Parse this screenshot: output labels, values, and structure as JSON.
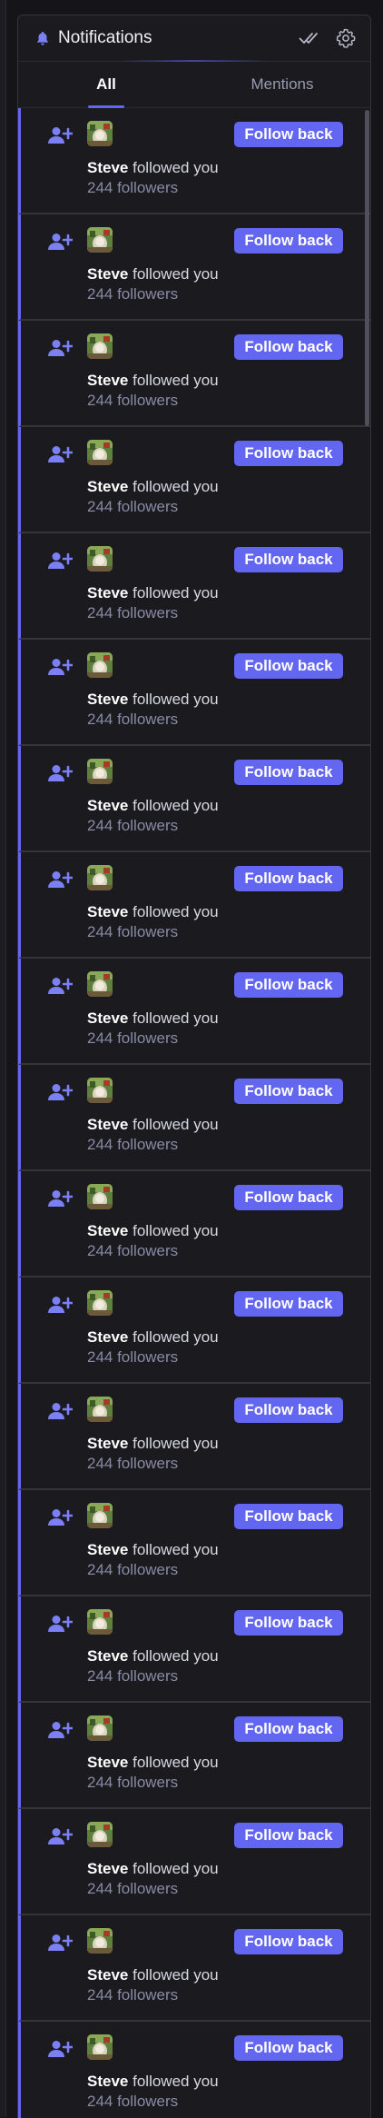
{
  "header": {
    "title": "Notifications",
    "icons": [
      "bell-icon",
      "mark-all-read-icon",
      "settings-gear-icon"
    ]
  },
  "tabs": [
    {
      "label": "All",
      "active": true
    },
    {
      "label": "Mentions",
      "active": false
    }
  ],
  "colors": {
    "accent": "#6366f1",
    "background": "#1a1a1f",
    "muted_text": "#8a8aa6"
  },
  "notifications": [
    {
      "user": "Steve",
      "action": "followed you",
      "followers": "244 followers",
      "button": "Follow back"
    },
    {
      "user": "Steve",
      "action": "followed you",
      "followers": "244 followers",
      "button": "Follow back"
    },
    {
      "user": "Steve",
      "action": "followed you",
      "followers": "244 followers",
      "button": "Follow back"
    },
    {
      "user": "Steve",
      "action": "followed you",
      "followers": "244 followers",
      "button": "Follow back"
    },
    {
      "user": "Steve",
      "action": "followed you",
      "followers": "244 followers",
      "button": "Follow back"
    },
    {
      "user": "Steve",
      "action": "followed you",
      "followers": "244 followers",
      "button": "Follow back"
    },
    {
      "user": "Steve",
      "action": "followed you",
      "followers": "244 followers",
      "button": "Follow back"
    },
    {
      "user": "Steve",
      "action": "followed you",
      "followers": "244 followers",
      "button": "Follow back"
    },
    {
      "user": "Steve",
      "action": "followed you",
      "followers": "244 followers",
      "button": "Follow back"
    },
    {
      "user": "Steve",
      "action": "followed you",
      "followers": "244 followers",
      "button": "Follow back"
    },
    {
      "user": "Steve",
      "action": "followed you",
      "followers": "244 followers",
      "button": "Follow back"
    },
    {
      "user": "Steve",
      "action": "followed you",
      "followers": "244 followers",
      "button": "Follow back"
    },
    {
      "user": "Steve",
      "action": "followed you",
      "followers": "244 followers",
      "button": "Follow back"
    },
    {
      "user": "Steve",
      "action": "followed you",
      "followers": "244 followers",
      "button": "Follow back"
    },
    {
      "user": "Steve",
      "action": "followed you",
      "followers": "244 followers",
      "button": "Follow back"
    },
    {
      "user": "Steve",
      "action": "followed you",
      "followers": "244 followers",
      "button": "Follow back"
    },
    {
      "user": "Steve",
      "action": "followed you",
      "followers": "244 followers",
      "button": "Follow back"
    },
    {
      "user": "Steve",
      "action": "followed you",
      "followers": "244 followers",
      "button": "Follow back"
    },
    {
      "user": "Steve",
      "action": "followed you",
      "followers": "244 followers",
      "button": "Follow back"
    }
  ]
}
